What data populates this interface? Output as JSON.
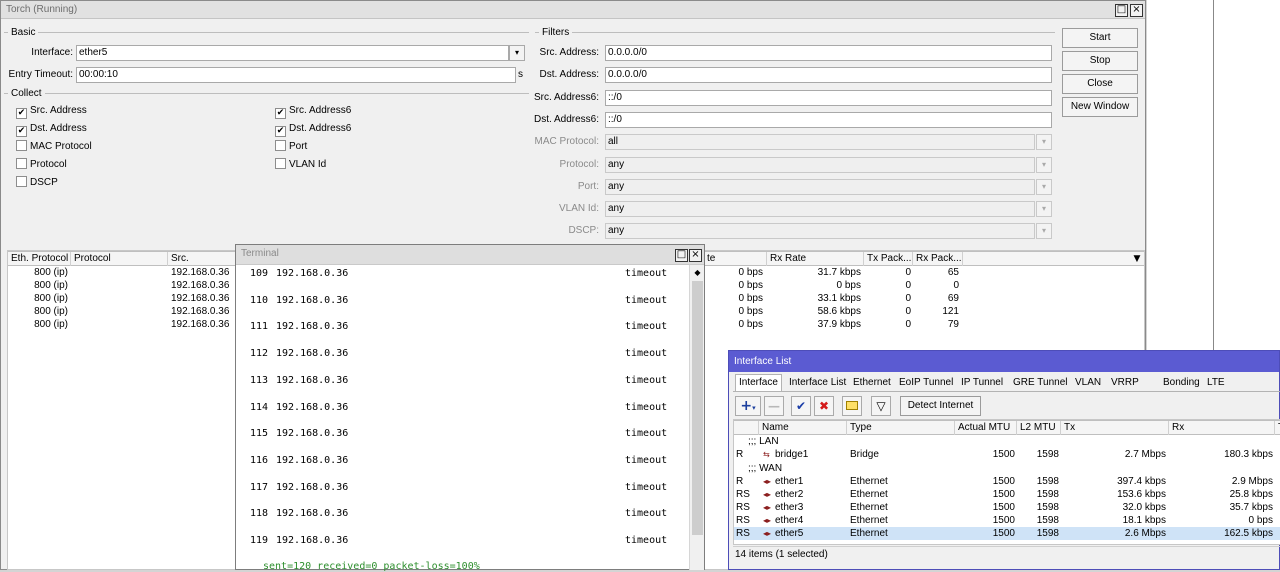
{
  "torch": {
    "title": "Torch (Running)",
    "basic_legend": "Basic",
    "interface_label": "Interface:",
    "interface_value": "ether5",
    "entry_timeout_label": "Entry Timeout:",
    "entry_timeout_value": "00:00:10",
    "entry_timeout_unit": "s",
    "collect_legend": "Collect",
    "collect": [
      {
        "label": "Src. Address",
        "checked": true
      },
      {
        "label": "Dst. Address",
        "checked": true
      },
      {
        "label": "MAC Protocol",
        "checked": false
      },
      {
        "label": "Protocol",
        "checked": false
      },
      {
        "label": "DSCP",
        "checked": false
      },
      {
        "label": "Src. Address6",
        "checked": true
      },
      {
        "label": "Dst. Address6",
        "checked": true
      },
      {
        "label": "Port",
        "checked": false
      },
      {
        "label": "VLAN Id",
        "checked": false
      }
    ],
    "filters_legend": "Filters",
    "filters": [
      {
        "label": "Src. Address:",
        "value": "0.0.0.0/0"
      },
      {
        "label": "Dst. Address:",
        "value": "0.0.0.0/0"
      },
      {
        "label": "Src. Address6:",
        "value": "::/0"
      },
      {
        "label": "Dst. Address6:",
        "value": "::/0"
      },
      {
        "label": "MAC Protocol:",
        "value": "all"
      },
      {
        "label": "Protocol:",
        "value": "any"
      },
      {
        "label": "Port:",
        "value": "any"
      },
      {
        "label": "VLAN Id:",
        "value": "any"
      },
      {
        "label": "DSCP:",
        "value": "any"
      }
    ],
    "buttons": {
      "start": "Start",
      "stop": "Stop",
      "close": "Close",
      "new_window": "New Window"
    },
    "table": {
      "headers": [
        "Eth. Protocol",
        "Protocol",
        "Src.",
        "te",
        "Rx Rate",
        "Tx Pack...",
        "Rx Pack..."
      ],
      "rows": [
        {
          "eth": "800 (ip)",
          "proto": "",
          "src": "192.168.0.36",
          "tx": "0 bps",
          "rx": "31.7 kbps",
          "txp": "0",
          "rxp": "65"
        },
        {
          "eth": "800 (ip)",
          "proto": "",
          "src": "192.168.0.36",
          "tx": "0 bps",
          "rx": "0 bps",
          "txp": "0",
          "rxp": "0"
        },
        {
          "eth": "800 (ip)",
          "proto": "",
          "src": "192.168.0.36",
          "tx": "0 bps",
          "rx": "33.1 kbps",
          "txp": "0",
          "rxp": "69"
        },
        {
          "eth": "800 (ip)",
          "proto": "",
          "src": "192.168.0.36",
          "tx": "0 bps",
          "rx": "58.6 kbps",
          "txp": "0",
          "rxp": "121"
        },
        {
          "eth": "800 (ip)",
          "proto": "",
          "src": "192.168.0.36",
          "tx": "0 bps",
          "rx": "37.9 kbps",
          "txp": "0",
          "rxp": "79"
        }
      ]
    }
  },
  "terminal": {
    "title": "Terminal",
    "lines": [
      {
        "seq": "109",
        "host": "192.168.0.36",
        "status": "timeout"
      },
      {
        "seq": "110",
        "host": "192.168.0.36",
        "status": "timeout"
      },
      {
        "seq": "111",
        "host": "192.168.0.36",
        "status": "timeout"
      },
      {
        "seq": "112",
        "host": "192.168.0.36",
        "status": "timeout"
      },
      {
        "seq": "113",
        "host": "192.168.0.36",
        "status": "timeout"
      },
      {
        "seq": "114",
        "host": "192.168.0.36",
        "status": "timeout"
      },
      {
        "seq": "115",
        "host": "192.168.0.36",
        "status": "timeout"
      },
      {
        "seq": "116",
        "host": "192.168.0.36",
        "status": "timeout"
      },
      {
        "seq": "117",
        "host": "192.168.0.36",
        "status": "timeout"
      },
      {
        "seq": "118",
        "host": "192.168.0.36",
        "status": "timeout"
      },
      {
        "seq": "119",
        "host": "192.168.0.36",
        "status": "timeout"
      }
    ],
    "summary": "sent=120 received=0 packet-loss=100%"
  },
  "iflist": {
    "title": "Interface List",
    "tabs": [
      "Interface",
      "Interface List",
      "Ethernet",
      "EoIP Tunnel",
      "IP Tunnel",
      "GRE Tunnel",
      "VLAN",
      "VRRP",
      "Bonding",
      "LTE"
    ],
    "detect_button": "Detect Internet",
    "headers": [
      "Name",
      "Type",
      "Actual MTU",
      "L2 MTU",
      "Tx",
      "Rx",
      "T"
    ],
    "sections": {
      "lan": ";;; LAN",
      "wan": ";;; WAN"
    },
    "rows": [
      {
        "flag": "R",
        "name": "bridge1",
        "type": "Bridge",
        "mtu": "1500",
        "l2mtu": "1598",
        "tx": "2.7 Mbps",
        "rx": "180.3 kbps"
      },
      {
        "flag": "R",
        "name": "ether1",
        "type": "Ethernet",
        "mtu": "1500",
        "l2mtu": "1598",
        "tx": "397.4 kbps",
        "rx": "2.9 Mbps"
      },
      {
        "flag": "RS",
        "name": "ether2",
        "type": "Ethernet",
        "mtu": "1500",
        "l2mtu": "1598",
        "tx": "153.6 kbps",
        "rx": "25.8 kbps"
      },
      {
        "flag": "RS",
        "name": "ether3",
        "type": "Ethernet",
        "mtu": "1500",
        "l2mtu": "1598",
        "tx": "32.0 kbps",
        "rx": "35.7 kbps"
      },
      {
        "flag": "RS",
        "name": "ether4",
        "type": "Ethernet",
        "mtu": "1500",
        "l2mtu": "1598",
        "tx": "18.1 kbps",
        "rx": "0 bps"
      },
      {
        "flag": "RS",
        "name": "ether5",
        "type": "Ethernet",
        "mtu": "1500",
        "l2mtu": "1598",
        "tx": "2.6 Mbps",
        "rx": "162.5 kbps"
      }
    ],
    "status": "14 items (1 selected)",
    "selected_index": 5
  },
  "colors": {
    "iflist_titlebar": "#5b5bd2",
    "selected_row": "#cfe3f7",
    "summary_green": "#2d8f2d",
    "terminal_titlebar": "#dedede"
  }
}
